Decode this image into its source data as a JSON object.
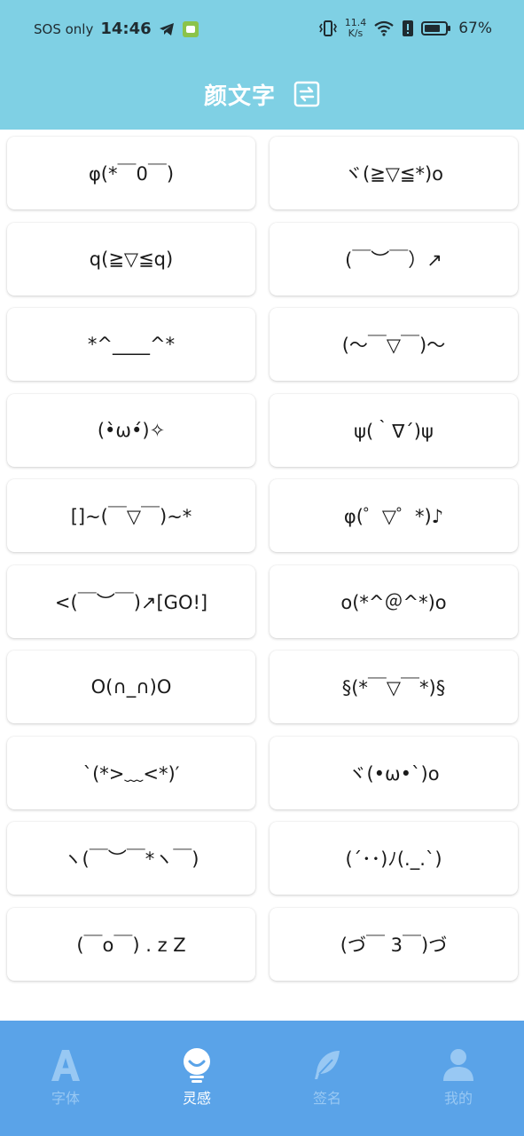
{
  "status_bar": {
    "sos": "SOS only",
    "time": "14:46",
    "speed_value": "11.4",
    "speed_unit": "K/s",
    "battery": "67%"
  },
  "header": {
    "title": "颜文字",
    "switch_icon": "refresh-swap-icon"
  },
  "emoticons": [
    "φ(*￣0￣)",
    "ヾ(≧▽≦*)o",
    "q(≧▽≦q)",
    "(￣︶￣）↗",
    "*^____^*",
    "(～￣▽￣)～",
    "(•̀ω•́)✧",
    "ψ(｀∇´)ψ",
    "[]~(￣▽￣)~*",
    "φ(゜▽゜*)♪",
    "<(￣︶￣)↗[GO!]",
    "o(*^＠^*)o",
    "O(∩_∩)O",
    "§(*￣▽￣*)§",
    "`(*>﹏<*)′",
    "ヾ(•ω•`)o",
    "ヽ(￣︶￣*ヽ￣)",
    "(´･･)ﾉ(._.`)",
    "(￣o￣) . z Z",
    "(づ￣ 3￣)づ"
  ],
  "tabs": [
    {
      "label": "字体",
      "icon": "font-a-icon",
      "active": false
    },
    {
      "label": "灵感",
      "icon": "lightbulb-icon",
      "active": true
    },
    {
      "label": "签名",
      "icon": "feather-icon",
      "active": false
    },
    {
      "label": "我的",
      "icon": "user-icon",
      "active": false
    }
  ],
  "colors": {
    "header_bg": "#7fd0e4",
    "tabbar_bg": "#5aa3e8",
    "tab_active": "#ffffff",
    "tab_inactive": "#98c8f3"
  }
}
